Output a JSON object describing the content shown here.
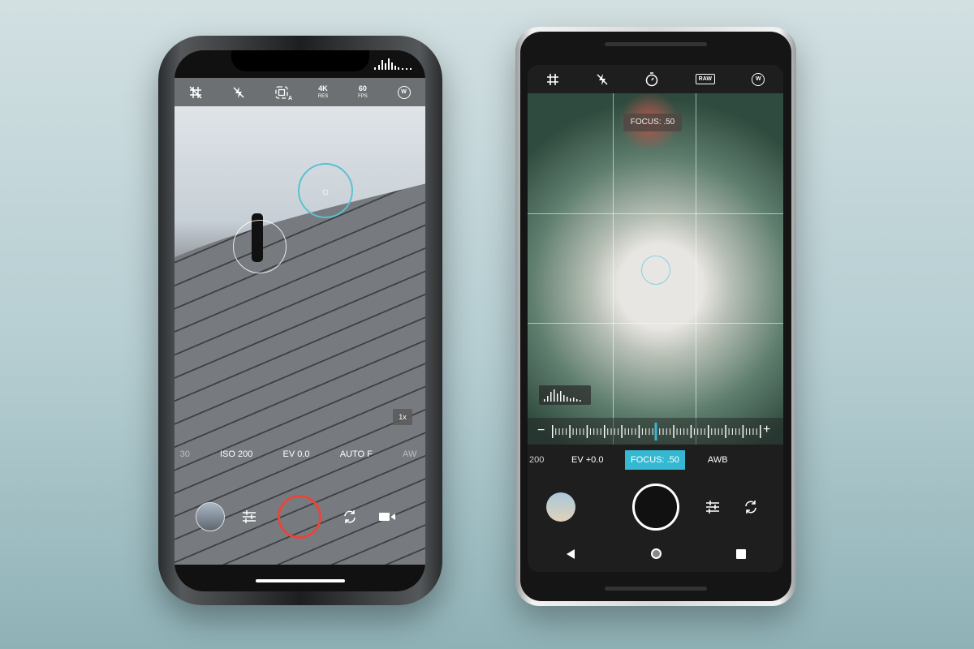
{
  "left_phone": {
    "toolbar": [
      {
        "icon": "grid-off-icon"
      },
      {
        "icon": "flash-off-icon"
      },
      {
        "icon": "auto-focus-icon",
        "label": "A"
      },
      {
        "label": "4K",
        "sub": "RES"
      },
      {
        "label": "60",
        "sub": "FPS"
      },
      {
        "icon": "white-balance-icon",
        "label": "W"
      }
    ],
    "zoom_label": "1x",
    "modes": [
      "30",
      "ISO 200",
      "EV 0.0",
      "AUTO F",
      "AW"
    ],
    "accent": "#5bc0d0",
    "shutter_color": "#e8453c"
  },
  "right_phone": {
    "toolbar": [
      {
        "icon": "grid-icon"
      },
      {
        "icon": "flash-off-icon"
      },
      {
        "icon": "timer-icon"
      },
      {
        "label": "RAW"
      },
      {
        "label": "W"
      }
    ],
    "focus_tooltip": "FOCUS: .50",
    "slider": {
      "minus": "−",
      "plus": "+",
      "value": 0.5
    },
    "modes": [
      "200",
      "EV +0.0",
      "FOCUS: .50",
      "AWB"
    ],
    "active_mode": "FOCUS: .50",
    "accent": "#35b8d2"
  }
}
